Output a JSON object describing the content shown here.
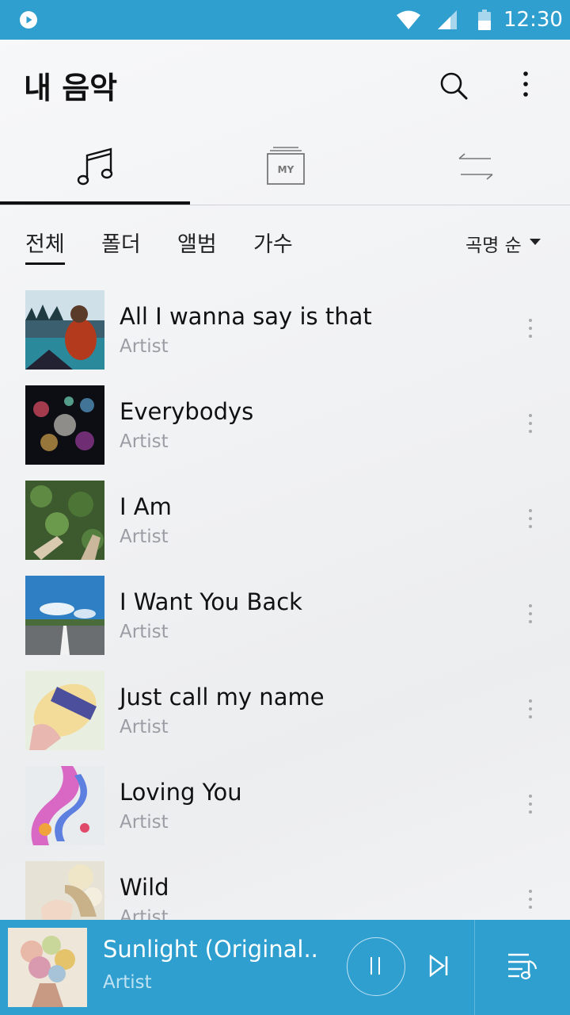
{
  "status_bar": {
    "time": "12:30",
    "icons": [
      "play-app-icon",
      "wifi-icon",
      "signal-icon",
      "battery-icon"
    ]
  },
  "header": {
    "title": "내 음악",
    "icons": [
      "search-icon",
      "more-vert-icon"
    ]
  },
  "main_tabs": [
    {
      "name": "songs",
      "icon": "music-note-icon",
      "active": true
    },
    {
      "name": "my",
      "icon": "my-playlist-icon",
      "label": "MY",
      "active": false
    },
    {
      "name": "transfer",
      "icon": "transfer-arrows-icon",
      "active": false
    }
  ],
  "filters": {
    "items": [
      "전체",
      "폴더",
      "앨범",
      "가수"
    ],
    "active_index": 0,
    "sort_label": "곡명 순"
  },
  "songs": [
    {
      "title": "All I wanna say is that",
      "artist": "Artist"
    },
    {
      "title": "Everybodys",
      "artist": "Artist"
    },
    {
      "title": "I Am",
      "artist": "Artist"
    },
    {
      "title": "I Want You Back",
      "artist": "Artist"
    },
    {
      "title": "Just call my name",
      "artist": "Artist"
    },
    {
      "title": "Loving You",
      "artist": "Artist"
    },
    {
      "title": "Wild",
      "artist": "Artist"
    }
  ],
  "now_playing": {
    "title": "Sunlight (Original..",
    "artist": "Artist",
    "controls": [
      "pause-icon",
      "skip-next-icon",
      "queue-icon"
    ]
  },
  "colors": {
    "accent": "#2f9fd0",
    "secondary_text": "#9a9ea4"
  }
}
